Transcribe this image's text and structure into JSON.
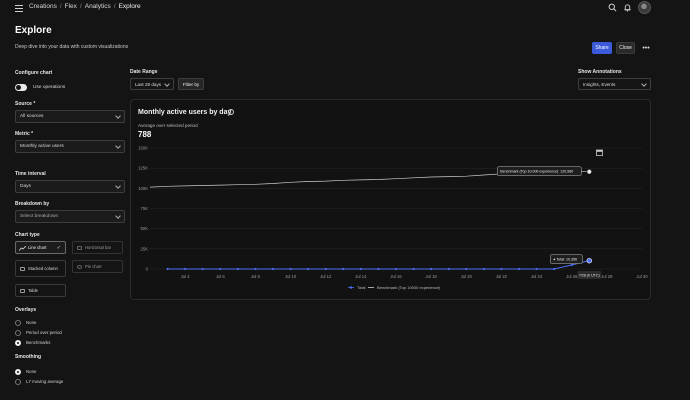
{
  "breadcrumb": [
    "Creations",
    "Flex",
    "Analytics",
    "Explore"
  ],
  "header": {
    "title": "Explore",
    "subtitle": "Deep dive into your data with custom visualizations",
    "share_label": "Share",
    "close_label": "Close",
    "more_label": "•••"
  },
  "config": {
    "heading": "Configure chart",
    "use_operations_label": "Use operations",
    "source_label": "Source *",
    "source_value": "All sources",
    "metric_label": "Metric *",
    "metric_value": "Monthly active users",
    "interval_label": "Time interval",
    "interval_value": "Days",
    "breakdown_label": "Breakdown by",
    "breakdown_placeholder": "Select breakdown",
    "chart_type_label": "Chart type",
    "chart_types": [
      {
        "label": "Line chart",
        "active": true
      },
      {
        "label": "Horizontal bar",
        "active": false
      },
      {
        "label": "Stacked column",
        "active": false
      },
      {
        "label": "Pie chart",
        "active": false
      },
      {
        "label": "Table",
        "active": false
      }
    ],
    "overlays_label": "Overlays",
    "overlays": [
      {
        "label": "None",
        "selected": false
      },
      {
        "label": "Period over period",
        "selected": false
      },
      {
        "label": "Benchmarks",
        "selected": true
      }
    ],
    "smoothing_label": "Smoothing",
    "smoothing": [
      {
        "label": "None",
        "selected": true
      },
      {
        "label": "L7 moving average",
        "selected": false
      }
    ]
  },
  "date_range": {
    "label": "Date Range",
    "value": "Last 28 days",
    "filter_label": "Filter by"
  },
  "annotations": {
    "label": "Show Annotations",
    "value": "Insights, Events"
  },
  "chart_data": {
    "type": "line",
    "title": "Monthly active users by day",
    "subtitle": "Average over selected period",
    "summary_value": "788",
    "x_ticks": [
      "Jul 4",
      "Jul 6",
      "Jul 8",
      "Jul 10",
      "Jul 12",
      "Jul 14",
      "Jul 16",
      "Jul 18",
      "Jul 20",
      "Jul 22",
      "Jul 24",
      "Jul 26",
      "Jul 28",
      "Jul 30"
    ],
    "y_ticks": [
      "150K",
      "125K",
      "100K",
      "75K",
      "50K",
      "25K",
      "0"
    ],
    "ylim": [
      0,
      150000
    ],
    "x_range": [
      2,
      30
    ],
    "series": [
      {
        "name": "Total",
        "color": "#4c6ef5",
        "x": [
          3,
          4,
          5,
          6,
          7,
          8,
          9,
          10,
          11,
          12,
          13,
          14,
          15,
          16,
          17,
          18,
          19,
          20,
          21,
          22,
          23,
          24,
          25,
          26,
          27
        ],
        "y": [
          0,
          0,
          0,
          0,
          0,
          0,
          0,
          0,
          0,
          0,
          0,
          0,
          0,
          0,
          0,
          0,
          0,
          0,
          0,
          0,
          0,
          0,
          0,
          5000,
          10356
        ]
      },
      {
        "name": "Benchmark (Top 10000 experience)",
        "color": "#cfcfcf",
        "x": [
          2,
          3,
          4,
          5,
          6,
          7,
          8,
          9,
          10,
          11,
          12,
          13,
          14,
          15,
          16,
          17,
          18,
          19,
          20,
          21,
          22,
          23,
          24,
          25,
          26,
          27
        ],
        "y": [
          101500,
          102500,
          103000,
          103500,
          104000,
          104500,
          105000,
          106000,
          107500,
          108500,
          109000,
          110000,
          110500,
          111000,
          112000,
          113000,
          114000,
          114500,
          115000,
          116500,
          118000,
          119000,
          120000,
          120500,
          120580,
          120580
        ]
      }
    ],
    "tooltips": {
      "benchmark": "Benchmark (Top 10,000 experience): 120,580",
      "total": "Total: 10,356",
      "date": "7/28 (h UTC)"
    },
    "legend": [
      "Total",
      "Benchmark (Top 10000 experience)"
    ],
    "legend_position": "bottom",
    "grid": true
  }
}
